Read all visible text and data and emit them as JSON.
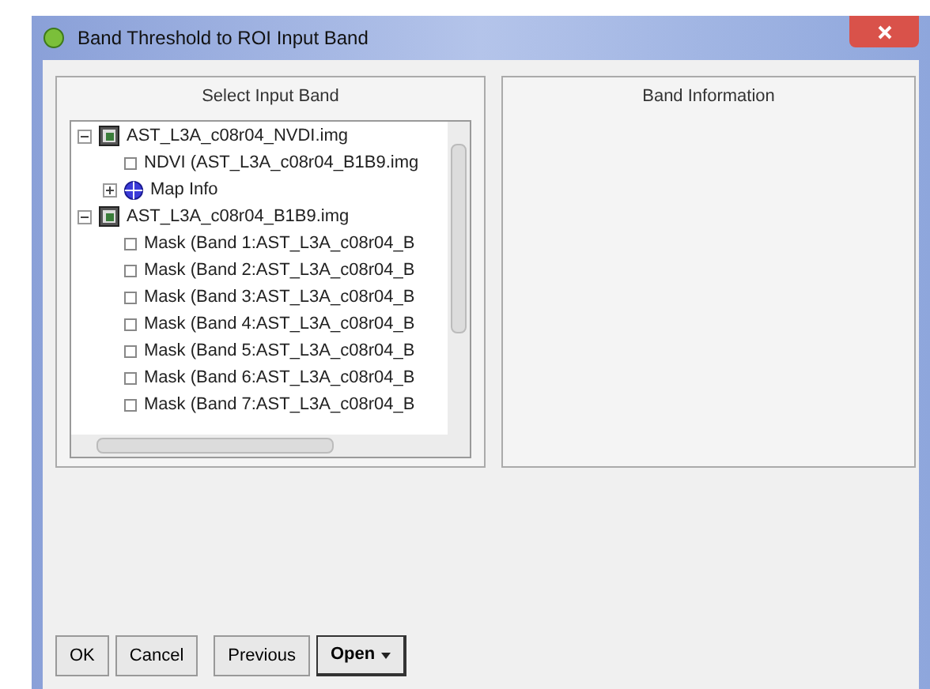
{
  "window": {
    "title": "Band Threshold to ROI Input Band"
  },
  "select_panel": {
    "title": "Select Input Band",
    "tree": [
      {
        "label": "AST_L3A_c08r04_NVDI.img",
        "kind": "file",
        "expanded": true,
        "children": [
          {
            "label": "NDVI (AST_L3A_c08r04_B1B9.img",
            "kind": "band"
          },
          {
            "label": "Map Info",
            "kind": "mapinfo",
            "expanded": false
          }
        ]
      },
      {
        "label": "AST_L3A_c08r04_B1B9.img",
        "kind": "file",
        "expanded": true,
        "children": [
          {
            "label": "Mask (Band 1:AST_L3A_c08r04_B",
            "kind": "band"
          },
          {
            "label": "Mask (Band 2:AST_L3A_c08r04_B",
            "kind": "band"
          },
          {
            "label": "Mask (Band 3:AST_L3A_c08r04_B",
            "kind": "band"
          },
          {
            "label": "Mask (Band 4:AST_L3A_c08r04_B",
            "kind": "band"
          },
          {
            "label": "Mask (Band 5:AST_L3A_c08r04_B",
            "kind": "band"
          },
          {
            "label": "Mask (Band 6:AST_L3A_c08r04_B",
            "kind": "band"
          },
          {
            "label": "Mask (Band 7:AST_L3A_c08r04_B",
            "kind": "band"
          }
        ]
      }
    ]
  },
  "info_panel": {
    "title": "Band Information"
  },
  "buttons": [
    {
      "label": "OK",
      "kind": "plain"
    },
    {
      "label": "Cancel",
      "kind": "plain"
    },
    {
      "label": "Previous",
      "kind": "plain"
    },
    {
      "label": "Open",
      "kind": "menu"
    }
  ]
}
